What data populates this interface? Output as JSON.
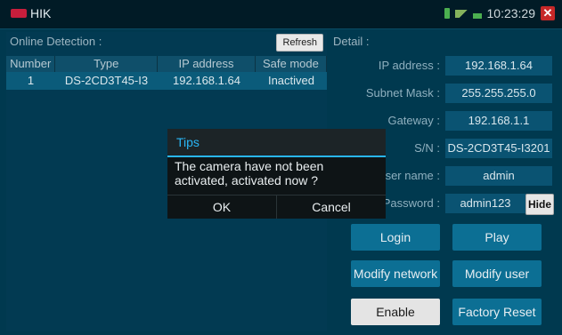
{
  "titlebar": {
    "app_name": "HIK",
    "time": "10:23:29"
  },
  "left": {
    "title": "Online Detection :",
    "refresh_label": "Refresh",
    "columns": [
      "Number",
      "Type",
      "IP address",
      "Safe mode"
    ],
    "rows": [
      {
        "number": "1",
        "type": "DS-2CD3T45-I3",
        "ip": "192.168.1.64",
        "safe_mode": "Inactived"
      }
    ]
  },
  "detail": {
    "title": "Detail :",
    "fields": [
      {
        "label": "IP address :",
        "value": "192.168.1.64"
      },
      {
        "label": "Subnet Mask :",
        "value": "255.255.255.0"
      },
      {
        "label": "Gateway :",
        "value": "192.168.1.1"
      },
      {
        "label": "S/N :",
        "value": "DS-2CD3T45-I3201"
      },
      {
        "label": "User name :",
        "value": "admin"
      },
      {
        "label": "Password :",
        "value": "admin123"
      }
    ],
    "hide_label": "Hide",
    "buttons": {
      "login": "Login",
      "play": "Play",
      "modify_network": "Modify network",
      "modify_user": "Modify user",
      "enable": "Enable",
      "factory_reset": "Factory Reset"
    }
  },
  "dialog": {
    "title": "Tips",
    "message": "The camera have not been activated, activated now ?",
    "ok": "OK",
    "cancel": "Cancel"
  },
  "colors": {
    "accent": "#29b6f6",
    "background": "#00394f",
    "close": "#c62828"
  }
}
